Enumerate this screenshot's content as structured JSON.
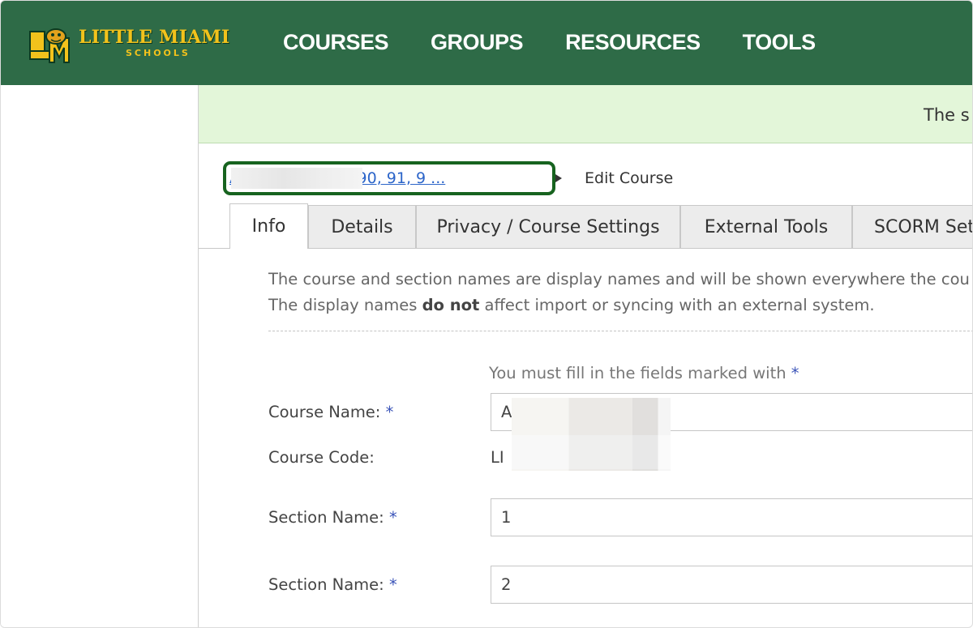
{
  "header": {
    "logo": {
      "title": "LITTLE MIAMI",
      "subtitle": "SCHOOLS",
      "mark_letters": "LM"
    },
    "nav": [
      "COURSES",
      "GROUPS",
      "RESOURCES",
      "TOOLS"
    ],
    "colors": {
      "header_bg": "#2e6b47",
      "logo_gold": "#f2c21c"
    }
  },
  "banner": {
    "text": "The s",
    "color": "#e3f6d9"
  },
  "breadcrumb": {
    "course_link": "A          y 1: 1, 2, 3, 4, 90, 91, 9 ...",
    "current": "Edit Course"
  },
  "tabs": [
    "Info",
    "Details",
    "Privacy / Course Settings",
    "External Tools",
    "SCORM Set"
  ],
  "info": {
    "line1": "The course and section names are display names and will be shown everywhere the cou",
    "line2_pre": "The display names ",
    "line2_bold": "do not",
    "line2_post": " affect import or syncing with an external system."
  },
  "form": {
    "required_note": "You must fill in the fields marked with ",
    "required_star": "*",
    "course_name_label": "Course Name: ",
    "course_name_value": "A",
    "course_code_label": "Course Code:",
    "course_code_value": "LI",
    "section_name_label": "Section Name: ",
    "section_1_value": "1",
    "section_2_value": "2"
  }
}
